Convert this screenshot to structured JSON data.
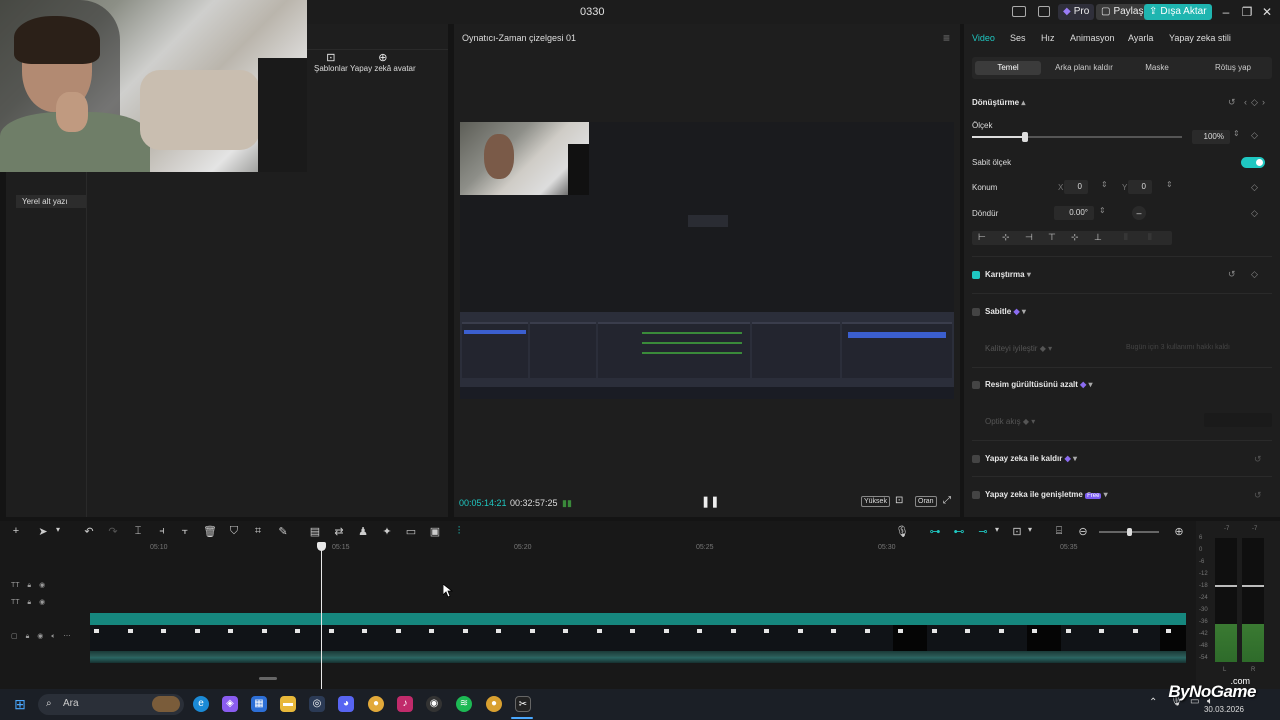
{
  "window": {
    "title": "0330",
    "pro_label": "Pro",
    "share_label": "Paylaş",
    "export_label": "Dışa Aktar"
  },
  "left_panel": {
    "tools": [
      {
        "label": "Şablonlar",
        "icon": "template-icon"
      },
      {
        "label": "Yapay zekâ avatar",
        "icon": "ai-avatar-icon"
      }
    ],
    "local_subtitle": "Yerel alt yazı"
  },
  "player": {
    "title": "Oynatıcı-Zaman çizelgesi 01",
    "current_time": "00:05:14:21",
    "total_time": "00:32:57:25",
    "quality_label": "Yüksek",
    "ratio_label": "Oran"
  },
  "inspector": {
    "tabs": [
      "Video",
      "Ses",
      "Hız",
      "Animasyon",
      "Ayarla",
      "Yapay zeka stili"
    ],
    "active_tab": "Video",
    "subtabs": [
      "Temel",
      "Arka planı kaldır",
      "Maske",
      "Rötuş yap"
    ],
    "transform_label": "Dönüştürme",
    "scale_label": "Ölçek",
    "scale_value": "100%",
    "scale_fraction": 0.25,
    "fixed_scale_label": "Sabit ölçek",
    "position_label": "Konum",
    "x_label": "X",
    "x_value": "0",
    "y_label": "Y",
    "y_value": "0",
    "rotate_label": "Döndür",
    "rotate_value": "0.00°",
    "blend_label": "Karıştırma",
    "stabilize_label": "Sabitle",
    "quality_improve_label": "Kaliteyi iyileştir",
    "quality_hint": "Bugün için 3 kullanımı hakkı kaldı",
    "denoise_label": "Resim gürültüsünü azalt",
    "optical_label": "Optik akış",
    "ai_remove_label": "Yapay zeka ile kaldır",
    "ai_expand_label": "Yapay zeka ile genişletme",
    "free_badge": "Free"
  },
  "timeline": {
    "ticks": [
      "05:10",
      "05:15",
      "05:20",
      "05:25",
      "05:30",
      "05:35"
    ]
  },
  "meters": {
    "scale": [
      "6",
      "0",
      "-6",
      "-12",
      "-18",
      "-24",
      "-30",
      "-36",
      "-42",
      "-48",
      "-54"
    ],
    "left_label": "L",
    "right_label": "R",
    "left_peak": "-7",
    "right_peak": "-7"
  },
  "taskbar": {
    "search_label": "Ara",
    "watermark": "ByNoGame",
    "watermark_suffix": ".com",
    "date": "30.03.2026"
  },
  "colors": {
    "accent": "#1fc7c1",
    "export": "#1fb5b0",
    "video_track": "#16877e"
  }
}
